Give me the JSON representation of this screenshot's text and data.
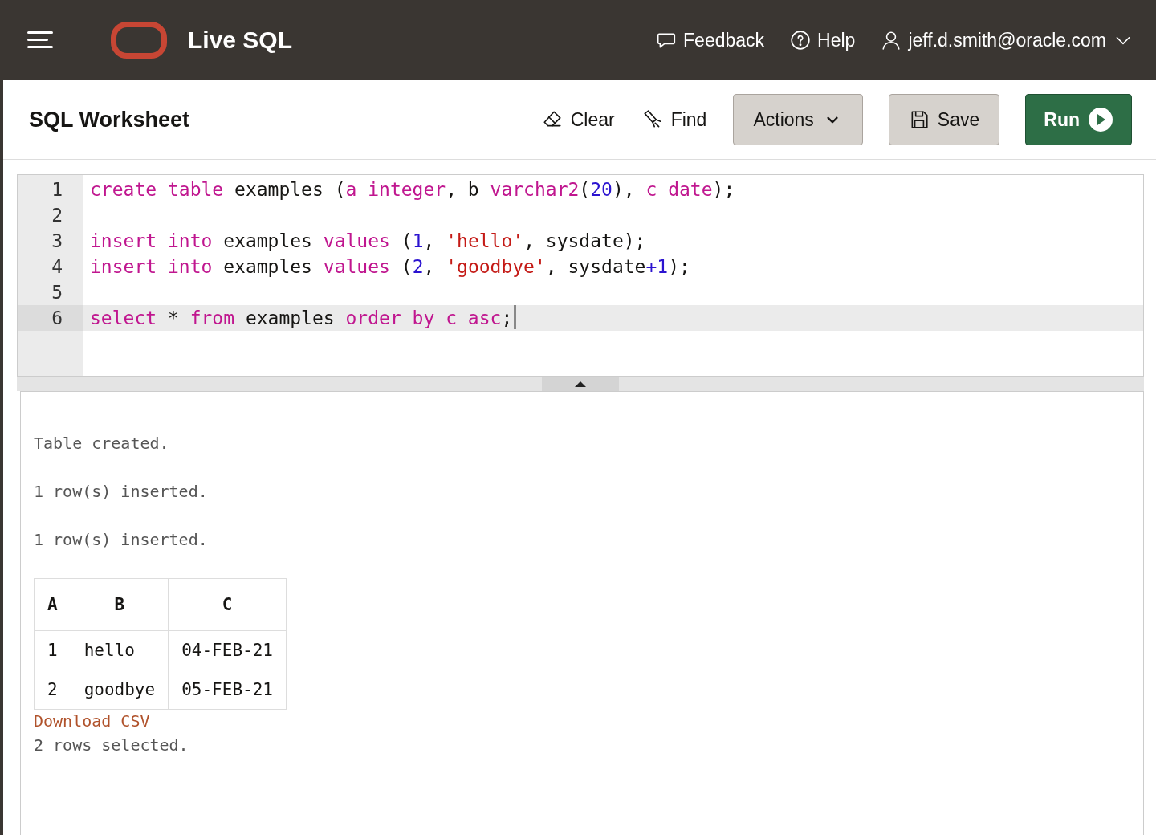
{
  "header": {
    "title": "Live SQL",
    "links": [
      {
        "label": "Feedback",
        "kind": "feedback"
      },
      {
        "label": "Help",
        "kind": "help"
      },
      {
        "label": "jeff.d.smith@oracle.com",
        "kind": "user"
      }
    ]
  },
  "toolbar": {
    "title": "SQL Worksheet",
    "buttons": [
      {
        "label": "Clear",
        "kind": "clear"
      },
      {
        "label": "Find",
        "kind": "find"
      },
      {
        "label": "Actions",
        "kind": "actions"
      },
      {
        "label": "Save",
        "kind": "save"
      },
      {
        "label": "Run",
        "kind": "run"
      }
    ]
  },
  "editor": {
    "lines": [
      {
        "number": "1",
        "current": false,
        "tokens": [
          {
            "text": "create",
            "kind": "keyword"
          },
          {
            "text": " table",
            "kind": "keyword"
          },
          {
            "text": " examples (",
            "kind": "plain"
          },
          {
            "text": "a",
            "kind": "keyword"
          },
          {
            "text": " integer",
            "kind": "keyword"
          },
          {
            "text": ", b ",
            "kind": "plain"
          },
          {
            "text": "varchar2",
            "kind": "keyword"
          },
          {
            "text": "(",
            "kind": "plain"
          },
          {
            "text": "20",
            "kind": "number"
          },
          {
            "text": "), ",
            "kind": "plain"
          },
          {
            "text": "c",
            "kind": "keyword"
          },
          {
            "text": " date",
            "kind": "keyword"
          },
          {
            "text": ");",
            "kind": "plain"
          }
        ]
      },
      {
        "number": "2",
        "current": false
      },
      {
        "number": "3",
        "current": false,
        "tokens": [
          {
            "text": "insert",
            "kind": "keyword"
          },
          {
            "text": " into",
            "kind": "keyword"
          },
          {
            "text": " examples ",
            "kind": "plain"
          },
          {
            "text": "values",
            "kind": "keyword"
          },
          {
            "text": " (",
            "kind": "plain"
          },
          {
            "text": "1",
            "kind": "number"
          },
          {
            "text": ", ",
            "kind": "plain"
          },
          {
            "text": "'hello'",
            "kind": "string"
          },
          {
            "text": ", sysdate);",
            "kind": "plain"
          }
        ]
      },
      {
        "number": "4",
        "current": false,
        "tokens": [
          {
            "text": "insert",
            "kind": "keyword"
          },
          {
            "text": " into",
            "kind": "keyword"
          },
          {
            "text": " examples ",
            "kind": "plain"
          },
          {
            "text": "values",
            "kind": "keyword"
          },
          {
            "text": " (",
            "kind": "plain"
          },
          {
            "text": "2",
            "kind": "number"
          },
          {
            "text": ", ",
            "kind": "plain"
          },
          {
            "text": "'goodbye'",
            "kind": "string"
          },
          {
            "text": ", sysdate",
            "kind": "plain"
          },
          {
            "text": "+",
            "kind": "operator"
          },
          {
            "text": "1",
            "kind": "number"
          },
          {
            "text": ");",
            "kind": "plain"
          }
        ]
      },
      {
        "number": "5",
        "current": false
      },
      {
        "number": "6",
        "current": true,
        "tokens": [
          {
            "text": "select",
            "kind": "keyword"
          },
          {
            "text": " * ",
            "kind": "plain"
          },
          {
            "text": "from",
            "kind": "keyword"
          },
          {
            "text": " examples ",
            "kind": "plain"
          },
          {
            "text": "order",
            "kind": "keyword"
          },
          {
            "text": " by",
            "kind": "keyword"
          },
          {
            "text": " c",
            "kind": "keyword"
          },
          {
            "text": " asc",
            "kind": "keyword"
          },
          {
            "text": ";",
            "kind": "plain"
          }
        ]
      }
    ]
  },
  "output": {
    "messages": [
      "Table created.",
      "1 row(s) inserted.",
      "1 row(s) inserted."
    ],
    "table": {
      "columns": [
        "A",
        "B",
        "C"
      ],
      "rows": [
        [
          "1",
          "hello",
          "04-FEB-21"
        ],
        [
          "2",
          "goodbye",
          "05-FEB-21"
        ]
      ]
    },
    "download_link": "Download CSV",
    "summary": "2 rows selected."
  }
}
